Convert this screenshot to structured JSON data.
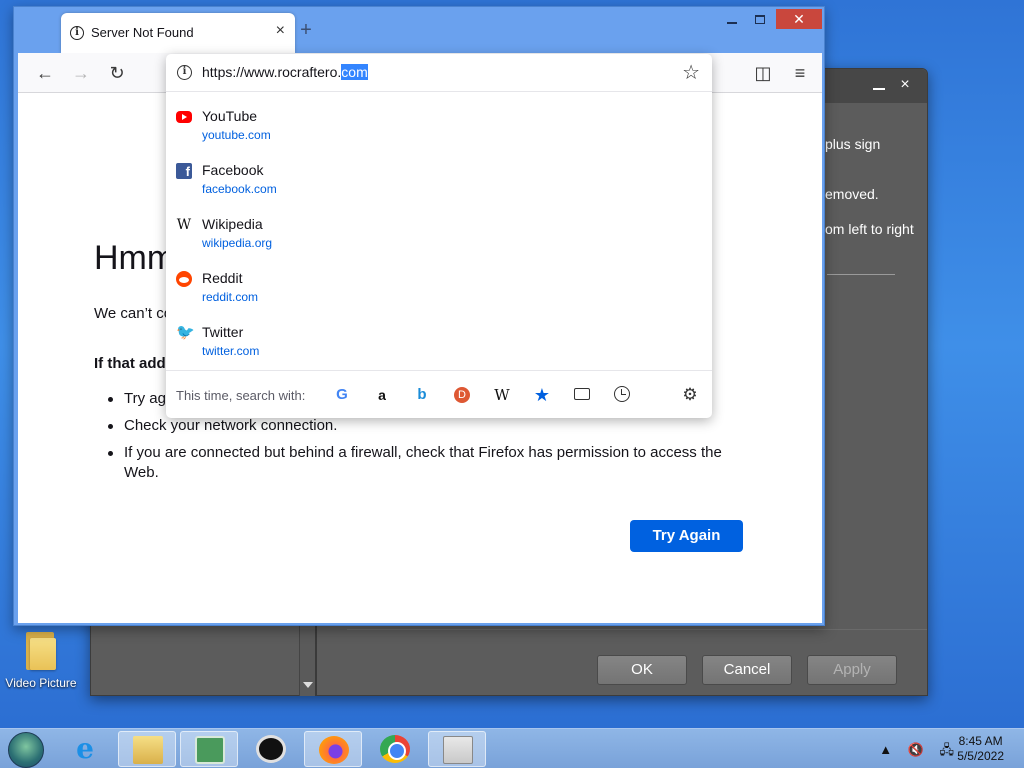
{
  "desktop": {
    "icon_label": "Video Picture"
  },
  "background_dialog": {
    "close_glyph": "×",
    "text_lines": [
      "plus sign",
      "emoved.",
      "om left to right"
    ],
    "buttons": {
      "ok": "OK",
      "cancel": "Cancel",
      "apply": "Apply"
    }
  },
  "browser": {
    "tab_title": "Server Not Found",
    "tab_close": "×",
    "new_tab": "+",
    "window_close": "✕",
    "nav": {
      "back": "←",
      "forward": "→",
      "reload": "↻",
      "pocket": "◫",
      "menu": "≡"
    },
    "page": {
      "heading": "Hmm",
      "line1": "We can’t co",
      "line2": "If that add",
      "bullets": [
        "Try ag",
        "Check your network connection.",
        "If you are connected but behind a firewall, check that Firefox has permission to access the Web."
      ],
      "try_again": "Try Again"
    },
    "urlbar": {
      "info_glyph": "i",
      "url_prefix": "https://www.rocraftero.",
      "url_selected": "com",
      "star": "☆"
    },
    "suggestions": [
      {
        "title": "YouTube",
        "url": "youtube.com",
        "icon": "youtube-icon"
      },
      {
        "title": "Facebook",
        "url": "facebook.com",
        "icon": "facebook-icon"
      },
      {
        "title": "Wikipedia",
        "url": "wikipedia.org",
        "icon": "wikipedia-icon"
      },
      {
        "title": "Reddit",
        "url": "reddit.com",
        "icon": "reddit-icon"
      },
      {
        "title": "Twitter",
        "url": "twitter.com",
        "icon": "twitter-icon"
      }
    ],
    "search_with_label": "This time, search with:",
    "engines": {
      "google": "G",
      "amazon": "a",
      "bing": "b",
      "duckduckgo": "D",
      "wikipedia": "W",
      "bookmarks": "★",
      "gear": "⚙"
    }
  },
  "taskbar": {
    "ie_glyph": "e",
    "time": "8:45 AM",
    "date": "5/5/2022",
    "tray_up": "▲",
    "tray_volume": "🔇",
    "tray_network": "🖧"
  },
  "colors": {
    "accent": "#0061e0",
    "link": "#0060df",
    "selection": "#3385ff",
    "close_red": "#c9473d"
  }
}
